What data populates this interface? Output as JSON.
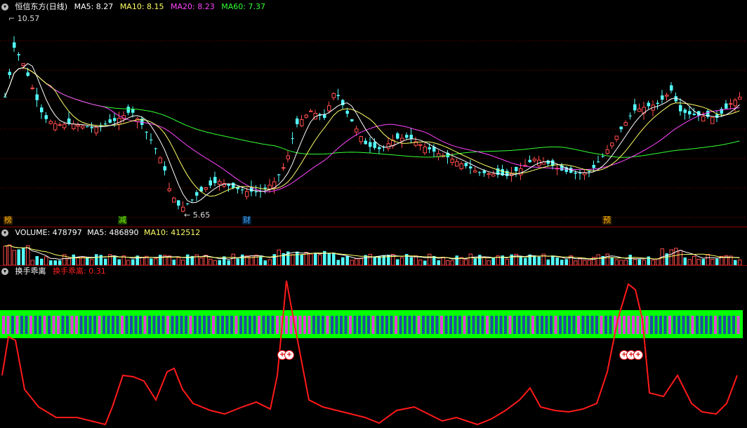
{
  "main_panel": {
    "title": "恒信东方(日线)",
    "ma5_label": "MA5: 8.27",
    "ma10_label": "MA10: 8.15",
    "ma20_label": "MA20: 8.23",
    "ma60_label": "MA60: 7.37",
    "high_label": "10.57",
    "low_label": "5.65",
    "markers": [
      {
        "id": "bang",
        "text": "榜",
        "color": "#ffb400"
      },
      {
        "id": "jian",
        "text": "减",
        "color": "#7CFC00"
      },
      {
        "id": "cai",
        "text": "财",
        "color": "#4aa8ff"
      },
      {
        "id": "yu",
        "text": "预",
        "color": "#ffb400"
      }
    ],
    "colors": {
      "up": "#ff4b4b",
      "down": "#54ffff",
      "ma5": "#ffffff",
      "ma10": "#ffff66",
      "ma20": "#ff44ff",
      "ma60": "#33ff33"
    }
  },
  "volume_panel": {
    "label": "VOLUME: 478797",
    "ma5_label": "MA5: 486890",
    "ma10_label": "MA10: 412512"
  },
  "indicator_panel": {
    "title": "换手乖离",
    "value_label": "换手乖离: 0.31"
  },
  "icons": {
    "panel_toggle": "circle-chevron-icon",
    "signal": "plus-circle-icon"
  }
}
